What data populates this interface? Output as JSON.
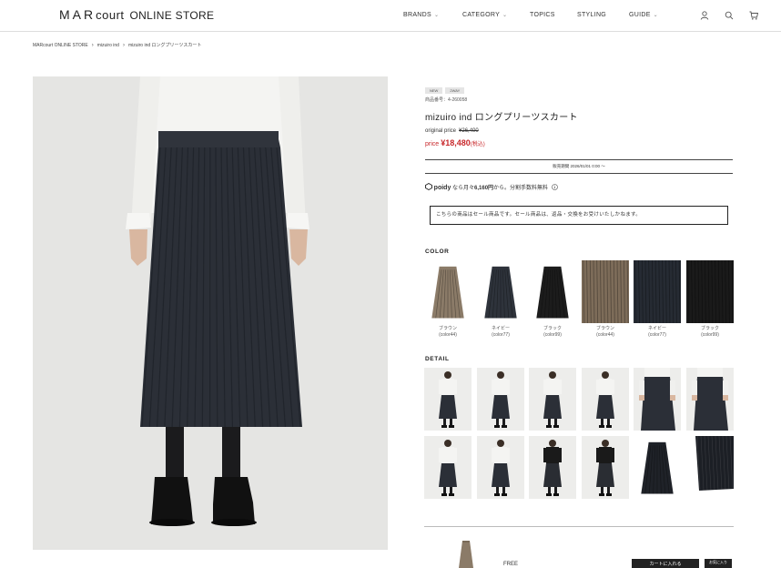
{
  "header": {
    "logo_mar": "MAR",
    "logo_court": "court",
    "logo_store": "ONLINE STORE",
    "nav": [
      {
        "label": "BRANDS",
        "has_dropdown": true
      },
      {
        "label": "CATEGORY",
        "has_dropdown": true
      },
      {
        "label": "TOPICS",
        "has_dropdown": false
      },
      {
        "label": "STYLING",
        "has_dropdown": false
      },
      {
        "label": "GUIDE",
        "has_dropdown": true
      }
    ],
    "icons": [
      "user-icon",
      "search-icon",
      "cart-icon"
    ]
  },
  "breadcrumb": [
    "MARcourt ONLINE STORE",
    "mizuiro ind",
    "mizuiro ind ロングプリーツスカート"
  ],
  "product": {
    "badges": [
      "NEW",
      "2WAY"
    ],
    "number": "商品番号：4-260058",
    "name": "mizuiro ind ロングプリーツスカート",
    "original_label": "original price",
    "original_price": "¥26,400",
    "price_label": "price",
    "price": "¥18,480",
    "tax_note": "(税込)",
    "sale_period": "販売期間 2026/01/01 0:00 ～",
    "poidy_brand": "poidy",
    "poidy_text_1": "なら月々",
    "poidy_amount": "6,160円",
    "poidy_text_2": "から。分割手数料無料",
    "notice": "こちらの商品はセール商品です。セール商品は、返品・交換をお受けいたしかねます。"
  },
  "color": {
    "title": "COLOR",
    "items": [
      {
        "name": "ブラウン",
        "code": "(color44)",
        "hex": "#8b7b68",
        "type": "skirt"
      },
      {
        "name": "ネイビー",
        "code": "(color77)",
        "hex": "#2e333b",
        "type": "skirt"
      },
      {
        "name": "ブラック",
        "code": "(color99)",
        "hex": "#1c1c1c",
        "type": "skirt"
      },
      {
        "name": "ブラウン",
        "code": "(color44)",
        "hex": "#7d6c59",
        "type": "fabric"
      },
      {
        "name": "ネイビー",
        "code": "(color77)",
        "hex": "#262b33",
        "type": "fabric"
      },
      {
        "name": "ブラック",
        "code": "(color99)",
        "hex": "#1a1a1a",
        "type": "fabric"
      }
    ]
  },
  "detail": {
    "title": "DETAIL",
    "count": 12
  },
  "purchase": {
    "size": "FREE",
    "cart_label": "カートに入れる",
    "fav_label": "お気に入り"
  },
  "colors": {
    "sale_red": "#c8282b",
    "skirt_navy": "#2b2f37",
    "background": "#e6e6e4"
  }
}
